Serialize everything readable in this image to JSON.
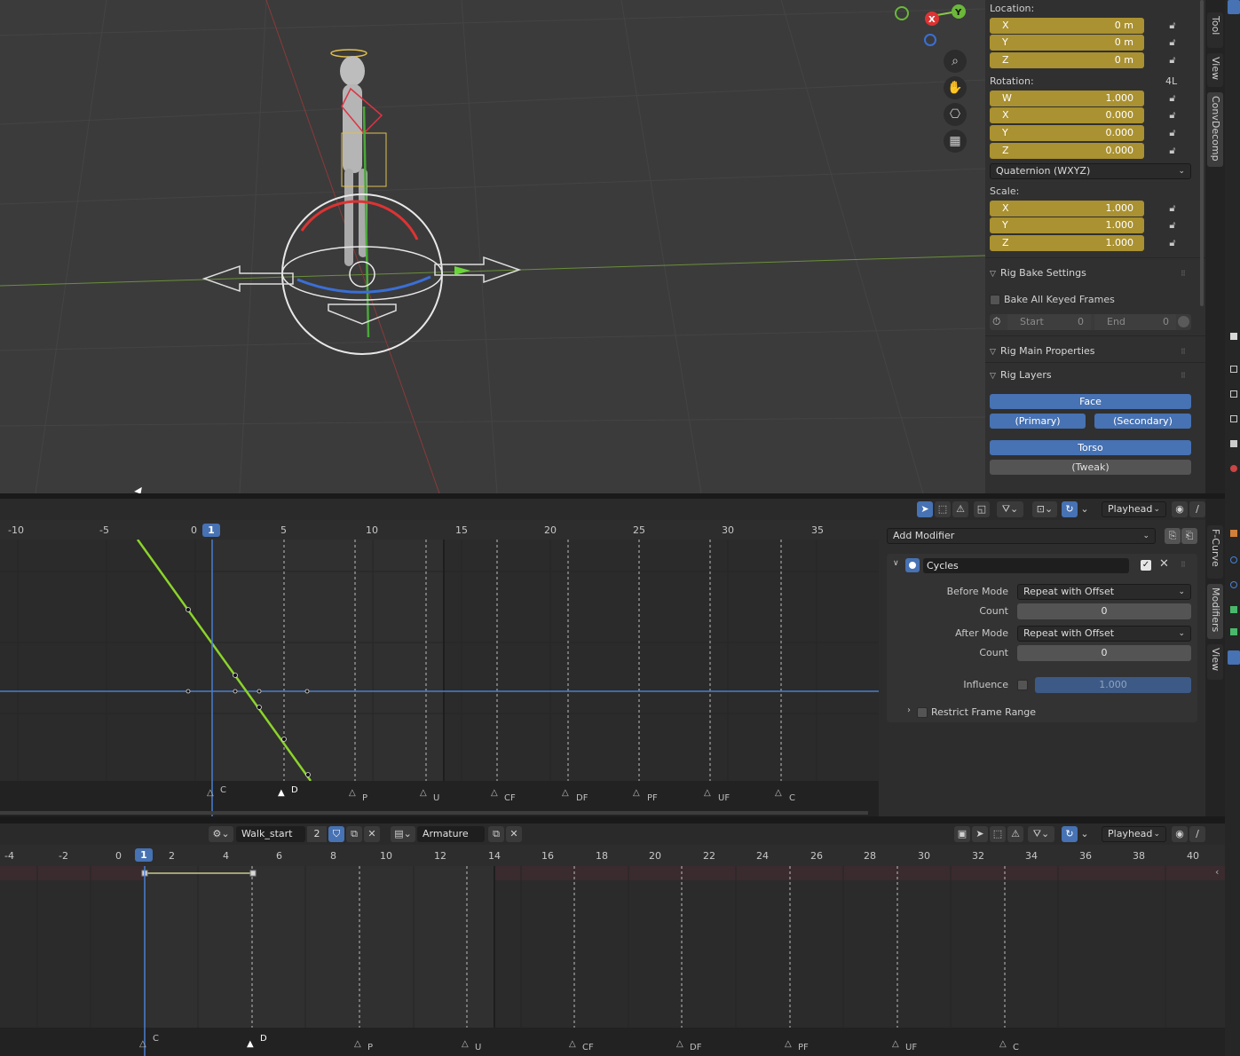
{
  "viewport": {
    "nav_icons": [
      "zoom-icon",
      "hand-icon",
      "camera-icon",
      "grid-icon"
    ],
    "axis_labels": {
      "x": "X",
      "y": "Y"
    }
  },
  "npanel": {
    "location_label": "Location:",
    "location": [
      {
        "axis": "X",
        "value": "0 m"
      },
      {
        "axis": "Y",
        "value": "0 m"
      },
      {
        "axis": "Z",
        "value": "0 m"
      }
    ],
    "rotation_label": "Rotation:",
    "rotation_mode_short": "4L",
    "rotation": [
      {
        "axis": "W",
        "value": "1.000"
      },
      {
        "axis": "X",
        "value": "0.000"
      },
      {
        "axis": "Y",
        "value": "0.000"
      },
      {
        "axis": "Z",
        "value": "0.000"
      }
    ],
    "rotation_mode": "Quaternion (WXYZ)",
    "scale_label": "Scale:",
    "scale": [
      {
        "axis": "X",
        "value": "1.000"
      },
      {
        "axis": "Y",
        "value": "1.000"
      },
      {
        "axis": "Z",
        "value": "1.000"
      }
    ],
    "rig_bake_settings": "Rig Bake Settings",
    "bake_all_keyed": "Bake All Keyed Frames",
    "start_label": "Start",
    "start_value": "0",
    "end_label": "End",
    "end_value": "0",
    "rig_main_properties": "Rig Main Properties",
    "rig_layers": "Rig Layers",
    "layers": {
      "face": "Face",
      "primary": "(Primary)",
      "secondary": "(Secondary)",
      "torso": "Torso",
      "tweak": "(Tweak)"
    },
    "tabs": [
      "Tool",
      "View",
      "ConvDecomp"
    ]
  },
  "graph": {
    "playhead_pivot": "Playhead",
    "current_frame": "1",
    "ruler": [
      "-10",
      "-5",
      "0",
      "5",
      "10",
      "15",
      "20",
      "25",
      "30",
      "35"
    ],
    "markers": [
      "C",
      "D",
      "P",
      "U",
      "CF",
      "DF",
      "PF",
      "UF",
      "C"
    ],
    "tabs": [
      "F-Curve",
      "Modifiers",
      "View"
    ]
  },
  "modifiers": {
    "add_modifier": "Add Modifier",
    "name": "Cycles",
    "before_mode_label": "Before Mode",
    "before_mode": "Repeat with Offset",
    "count_label": "Count",
    "before_count": "0",
    "after_mode_label": "After Mode",
    "after_mode": "Repeat with Offset",
    "after_count": "0",
    "influence_label": "Influence",
    "influence": "1.000",
    "restrict_frame_range": "Restrict Frame Range"
  },
  "dopesheet": {
    "action_name": "Walk_start",
    "action_users": "2",
    "object_name": "Armature",
    "playhead_pivot": "Playhead",
    "current_frame": "1",
    "ruler": [
      "-4",
      "-2",
      "0",
      "2",
      "4",
      "6",
      "8",
      "10",
      "12",
      "14",
      "16",
      "18",
      "20",
      "22",
      "24",
      "26",
      "28",
      "30",
      "32",
      "34",
      "36",
      "38",
      "40"
    ],
    "markers": [
      "C",
      "D",
      "P",
      "U",
      "CF",
      "DF",
      "PF",
      "UF",
      "C"
    ]
  }
}
